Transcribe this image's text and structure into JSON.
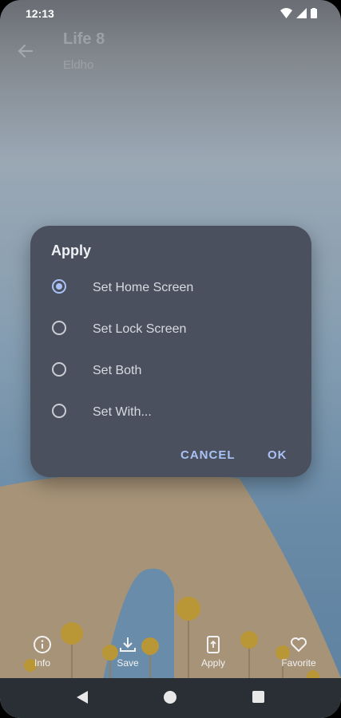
{
  "status_bar": {
    "time": "12:13"
  },
  "app_bar": {
    "title": "Life 8",
    "subtitle": "Eldho"
  },
  "dialog": {
    "title": "Apply",
    "options": [
      {
        "label": "Set Home Screen",
        "selected": true
      },
      {
        "label": "Set Lock Screen",
        "selected": false
      },
      {
        "label": "Set Both",
        "selected": false
      },
      {
        "label": "Set With...",
        "selected": false
      }
    ],
    "cancel_label": "CANCEL",
    "ok_label": "OK"
  },
  "bottom_bar": {
    "items": [
      {
        "label": "Info",
        "icon": "info-icon"
      },
      {
        "label": "Save",
        "icon": "download-icon"
      },
      {
        "label": "Apply",
        "icon": "apply-phone-icon"
      },
      {
        "label": "Favorite",
        "icon": "heart-icon"
      }
    ]
  },
  "colors": {
    "accent": "#a9c2f5",
    "dialog_bg": "#4b505e"
  }
}
